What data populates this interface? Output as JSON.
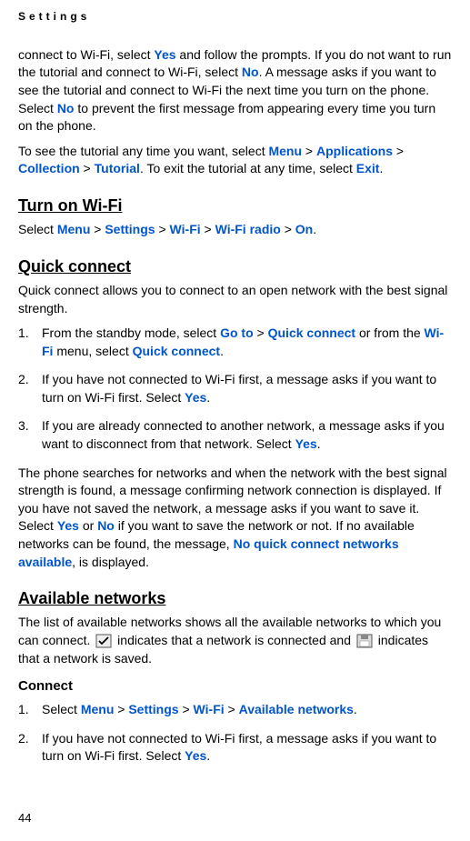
{
  "header": "Settings",
  "para1": {
    "p1a": "connect to Wi-Fi, select ",
    "yes1": "Yes",
    "p1b": " and follow the prompts. If you do not want to run the tutorial and connect to Wi-Fi, select ",
    "no1": "No",
    "p1c": ". A message asks if you want to see the tutorial and connect to Wi-Fi the next time you turn on the phone. Select ",
    "no2": "No",
    "p1d": " to prevent the first message from appearing every time you turn on the phone."
  },
  "para2": {
    "p2a": "To see the tutorial any time you want, select ",
    "menu": "Menu",
    "sep": " > ",
    "applications": "Applications",
    "collection": "Collection",
    "tutorial": "Tutorial",
    "p2b": ". To exit the tutorial at any time, select ",
    "exit": "Exit",
    "p2c": "."
  },
  "turnon": {
    "heading": "Turn on Wi-Fi",
    "pa": "Select ",
    "menu": "Menu",
    "sep": " > ",
    "settings": "Settings",
    "wifi": "Wi-Fi",
    "wifiradio": "Wi-Fi radio",
    "on": "On",
    "pend": "."
  },
  "quickconnect": {
    "heading": "Quick connect",
    "intro": "Quick connect allows you to connect to an open network with the best signal strength.",
    "step1a": "From the standby mode, select ",
    "goto": "Go to",
    "sep": " > ",
    "quickconnect_link": "Quick connect",
    "step1b": " or from the ",
    "wifi": "Wi-Fi",
    "step1c": " menu, select ",
    "quickconnect_link2": "Quick connect",
    "step1d": ".",
    "step2a": "If you have not connected to Wi-Fi first, a message asks if you want to turn on Wi-Fi first. Select ",
    "yes": "Yes",
    "step2b": ".",
    "step3a": "If you are already connected to another network, a message asks if you want to disconnect from that network. Select ",
    "step3b": ".",
    "postPara_a": "The phone searches for networks and when the network with the best signal strength is found, a message confirming network connection is displayed. If you have not saved the network, a message asks if you want to save it. Select ",
    "or": " or ",
    "no": "No",
    "postPara_b": " if you want to save the network or not. If no available networks can be found, the message, ",
    "noquickmsg": "No quick connect networks available",
    "postPara_c": ", is displayed."
  },
  "available": {
    "heading": "Available networks",
    "intro_a": "The list of available networks shows all the available networks to which you can connect. ",
    "intro_b": " indicates that a network is connected and ",
    "intro_c": " indicates that a network is saved.",
    "connect_heading": "Connect",
    "step1a": "Select ",
    "menu": "Menu",
    "sep": " > ",
    "settings": "Settings",
    "wifi": "Wi-Fi",
    "availnet": "Available networks",
    "step1b": ".",
    "step2a": "If you have not connected to Wi-Fi first, a message asks if you want to turn on Wi-Fi first. Select ",
    "yes": "Yes",
    "step2b": "."
  },
  "pageNumber": "44"
}
